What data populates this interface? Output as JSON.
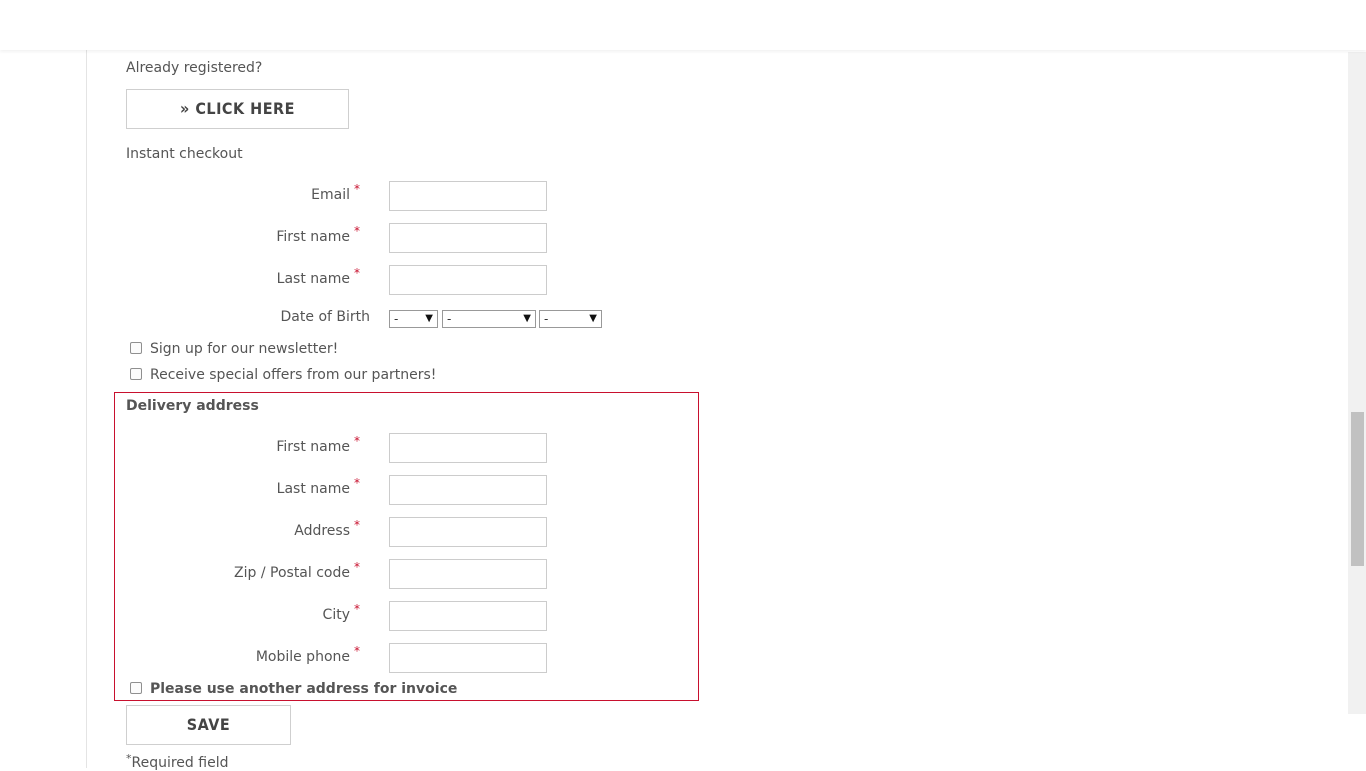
{
  "login": {
    "title": "Already registered?",
    "button_label": "» CLICK HERE"
  },
  "checkout": {
    "title": "Instant checkout",
    "required_mark": "*",
    "fields": {
      "email": {
        "label": "Email",
        "value": ""
      },
      "first_name": {
        "label": "First name",
        "value": ""
      },
      "last_name": {
        "label": "Last name",
        "value": ""
      }
    },
    "dob": {
      "label": "Date of Birth",
      "day": "-",
      "month": "-",
      "year": "-"
    },
    "newsletter_label": "Sign up for our newsletter!",
    "partners_label": "Receive special offers from our partners!"
  },
  "delivery": {
    "title": "Delivery address",
    "fields": {
      "first_name": {
        "label": "First name",
        "value": ""
      },
      "last_name": {
        "label": "Last name",
        "value": ""
      },
      "address": {
        "label": "Address",
        "value": ""
      },
      "zip": {
        "label": "Zip / Postal code",
        "value": ""
      },
      "city": {
        "label": "City",
        "value": ""
      },
      "mobile": {
        "label": "Mobile phone",
        "value": ""
      }
    },
    "invoice_label": "Please use another address for invoice"
  },
  "save_label": "SAVE",
  "required_note": {
    "mark": "*",
    "text": "Required field"
  },
  "colors": {
    "accent_required": "#c8102e",
    "text": "#555555",
    "border": "#cccccc"
  }
}
